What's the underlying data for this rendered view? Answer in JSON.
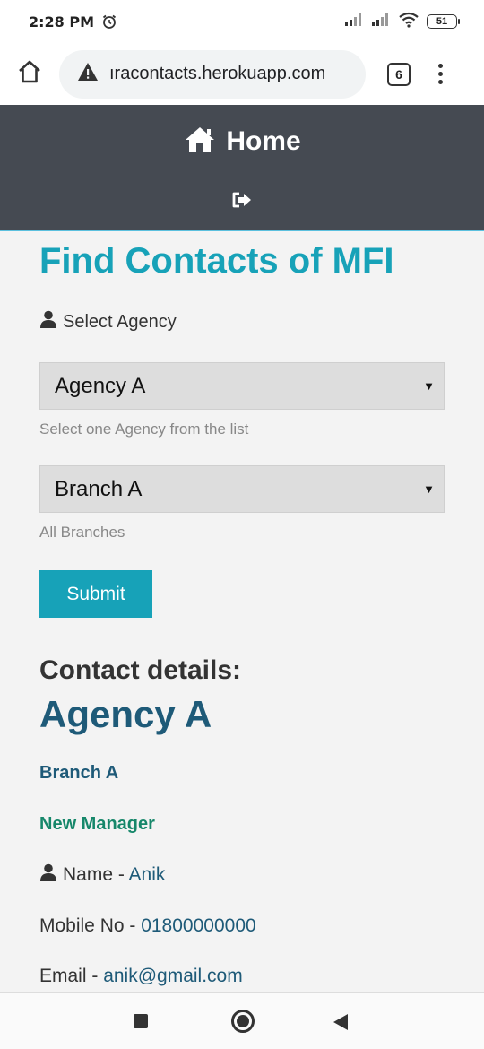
{
  "status_bar": {
    "time": "2:28 PM",
    "battery": "51"
  },
  "browser": {
    "url": "ıracontacts.herokuapp.com",
    "tab_count": "6"
  },
  "navbar": {
    "home_label": "Home"
  },
  "form": {
    "title": "Find Contacts of MFI",
    "agency_label": "Select Agency",
    "agency_selected": "Agency A",
    "agency_help": "Select one Agency from the list",
    "branch_selected": "Branch A",
    "branch_help": "All Branches",
    "submit_label": "Submit"
  },
  "contact": {
    "heading": "Contact details:",
    "agency": "Agency A",
    "branch": "Branch A",
    "role": "New Manager",
    "name_label": "Name - ",
    "name_value": "Anik",
    "mobile_label": "Mobile No - ",
    "mobile_value": "01800000000",
    "email_label": "Email - ",
    "email_value": "anik@gmail.com"
  },
  "colors": {
    "accent": "#17a2b8",
    "navbar": "#454a52",
    "link_blue": "#1e5a78",
    "green": "#16876a"
  }
}
